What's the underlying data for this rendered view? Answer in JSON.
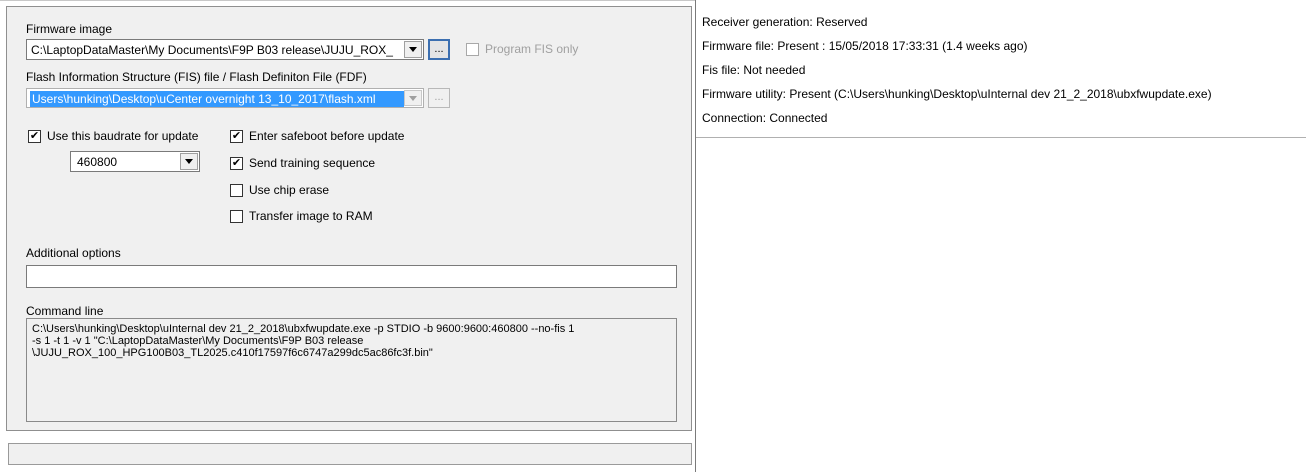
{
  "left": {
    "firmware_image_label": "Firmware image",
    "firmware_image_value": "C:\\LaptopDataMaster\\My Documents\\F9P B03 release\\JUJU_ROX_",
    "browse_label": "...",
    "program_fis_only_label": "Program FIS only",
    "program_fis_only_checked": false,
    "fis_label": "Flash Information Structure (FIS) file / Flash Definiton File (FDF)",
    "fis_value": "Users\\hunking\\Desktop\\uCenter overnight 13_10_2017\\flash.xml",
    "fis_browse_label": "...",
    "use_baudrate_label": "Use this baudrate for update",
    "use_baudrate_checked": true,
    "baudrate_value": "460800",
    "enter_safeboot_label": "Enter safeboot before update",
    "enter_safeboot_checked": true,
    "send_training_label": "Send training sequence",
    "send_training_checked": true,
    "use_chip_erase_label": "Use chip erase",
    "use_chip_erase_checked": false,
    "transfer_ram_label": "Transfer image to RAM",
    "transfer_ram_checked": false,
    "additional_options_label": "Additional options",
    "additional_options_value": "",
    "command_line_label": "Command line",
    "command_line_lines": [
      "C:\\Users\\hunking\\Desktop\\uInternal dev 21_2_2018\\ubxfwupdate.exe -p STDIO -b 9600:9600:460800 --no-fis 1",
      "-s 1 -t 1 -v 1 \"C:\\LaptopDataMaster\\My Documents\\F9P B03 release",
      "\\JUJU_ROX_100_HPG100B03_TL2025.c410f17597f6c6747a299dc5ac86fc3f.bin\""
    ]
  },
  "right": {
    "receiver_generation": "Receiver generation: Reserved",
    "firmware_file": "Firmware file: Present : 15/05/2018  17:33:31 (1.4 weeks ago)",
    "fis_file": "Fis file: Not needed",
    "firmware_utility": "Firmware utility: Present (C:\\Users\\hunking\\Desktop\\uInternal dev 21_2_2018\\ubxfwupdate.exe)",
    "connection": "Connection: Connected"
  },
  "colors": {
    "dialog_bg": "#f0f0f0",
    "selection_bg": "#3399ff",
    "disabled_text": "#a0a0a0"
  }
}
